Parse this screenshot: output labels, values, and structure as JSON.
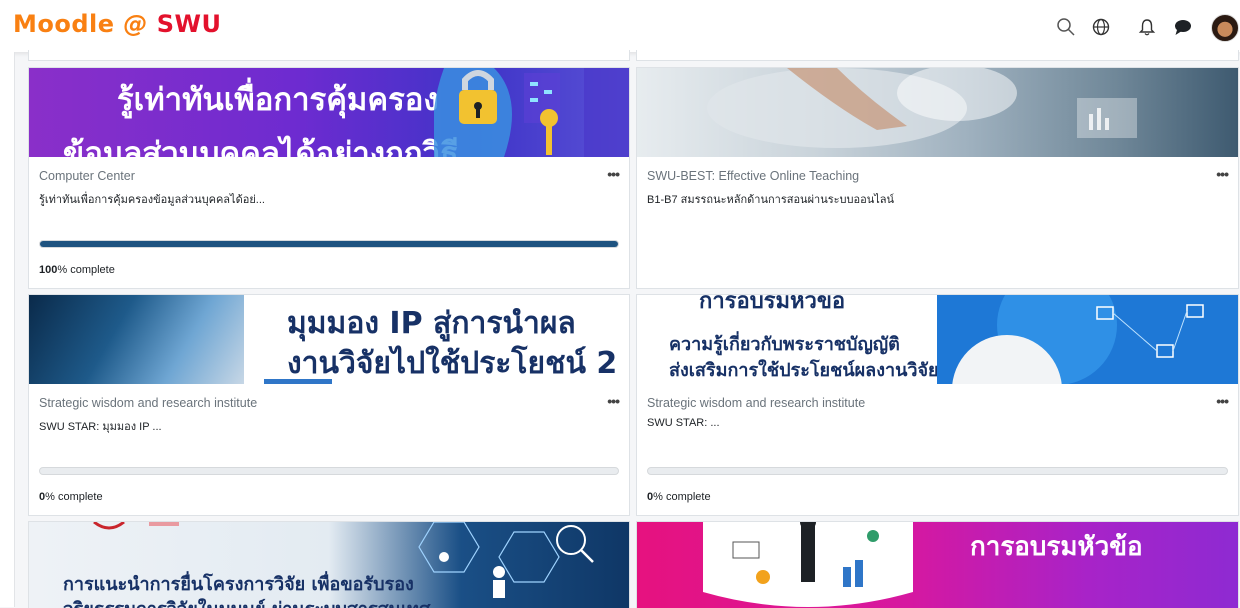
{
  "header": {
    "logo_moodle": "Moodle",
    "logo_at": "@",
    "logo_swu": "SWU",
    "icons": [
      "search-icon",
      "globe-icon",
      "bell-icon",
      "chat-icon",
      "avatar"
    ]
  },
  "colors": {
    "logo_orange": "#f98012",
    "logo_red": "#e3112c",
    "progress": "#1e5380"
  },
  "courses": [
    {
      "category": "Computer Center",
      "title": "รู้เท่าทันเพื่อการคุ้มครองข้อมูลส่วนบุคคลได้อย่...",
      "banner_line1": "รู้เท่าทันเพื่อการคุ้มครอง",
      "banner_line2": "ข้อมูลส่วนบุคคลได้อย่างถูกวิธี",
      "progress": 100,
      "progress_pct": "100",
      "progress_suffix": "% complete"
    },
    {
      "category": "SWU-BEST: Effective Online Teaching",
      "title": "B1-B7 สมรรถนะหลักด้านการสอนผ่านระบบออนไลน์",
      "progress": null
    },
    {
      "category": "Strategic wisdom and research institute",
      "title": "SWU STAR: มุมมอง IP ...",
      "banner_line1": "มุมมอง IP สู่การนำผล",
      "banner_line2": "งานวิจัยไปใช้ประโยชน์ 2",
      "progress": 0,
      "progress_pct": "0",
      "progress_suffix": "% complete"
    },
    {
      "category": "Strategic wisdom and research institute",
      "title": "SWU STAR: ...",
      "banner_line0": "การอบรมหัวข้อ",
      "banner_line1": "ความรู้เกี่ยวกับพระราชบัญญัติ",
      "banner_line2": "ส่งเสริมการใช้ประโยชน์ผลงานวิจัย",
      "progress": 0,
      "progress_pct": "0",
      "progress_suffix": "% complete"
    },
    {
      "banner_line1": "การแนะนำการยื่นโครงการวิจัย เพื่อขอรับรอง",
      "banner_line2": "จริยธรรมการวิจัยในมนุษย์ ผ่านระบบสารสนเทศ"
    },
    {
      "banner_line1": "การอบรมหัวข้อ"
    }
  ]
}
